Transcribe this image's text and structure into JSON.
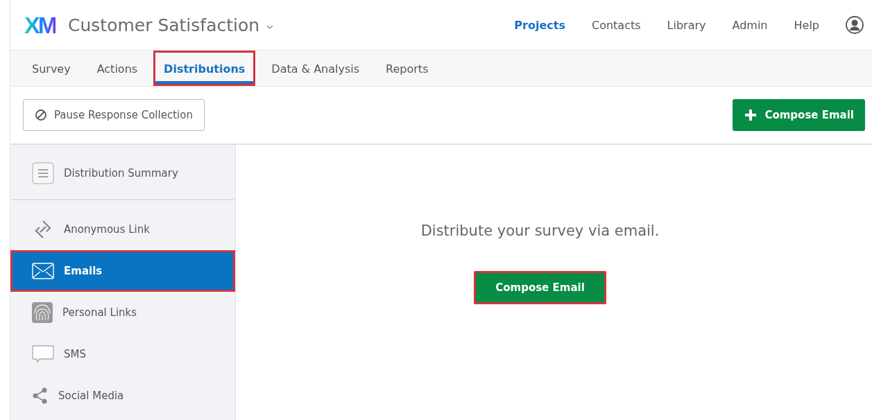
{
  "header": {
    "logo": "XM",
    "project_title": "Customer Satisfaction",
    "nav": [
      {
        "label": "Projects",
        "selected": true
      },
      {
        "label": "Contacts",
        "selected": false
      },
      {
        "label": "Library",
        "selected": false
      },
      {
        "label": "Admin",
        "selected": false
      },
      {
        "label": "Help",
        "selected": false
      }
    ]
  },
  "tabs": [
    {
      "label": "Survey",
      "selected": false,
      "highlighted": false
    },
    {
      "label": "Actions",
      "selected": false,
      "highlighted": false
    },
    {
      "label": "Distributions",
      "selected": true,
      "highlighted": true
    },
    {
      "label": "Data & Analysis",
      "selected": false,
      "highlighted": false
    },
    {
      "label": "Reports",
      "selected": false,
      "highlighted": false
    }
  ],
  "toolbar": {
    "pause_button": "Pause Response Collection",
    "compose_button": "Compose Email"
  },
  "sidebar": {
    "items": [
      {
        "kind": "summary",
        "label": "Distribution Summary",
        "selected": false,
        "highlighted": false
      },
      {
        "kind": "link",
        "label": "Anonymous Link",
        "selected": false,
        "highlighted": false
      },
      {
        "kind": "email",
        "label": "Emails",
        "selected": true,
        "highlighted": true
      },
      {
        "kind": "fingerprint",
        "label": "Personal Links",
        "selected": false,
        "highlighted": false
      },
      {
        "kind": "sms",
        "label": "SMS",
        "selected": false,
        "highlighted": false
      },
      {
        "kind": "share",
        "label": "Social Media",
        "selected": false,
        "highlighted": false
      }
    ]
  },
  "main": {
    "message": "Distribute your survey via email.",
    "compose_button": {
      "label": "Compose Email",
      "highlighted": true
    }
  }
}
